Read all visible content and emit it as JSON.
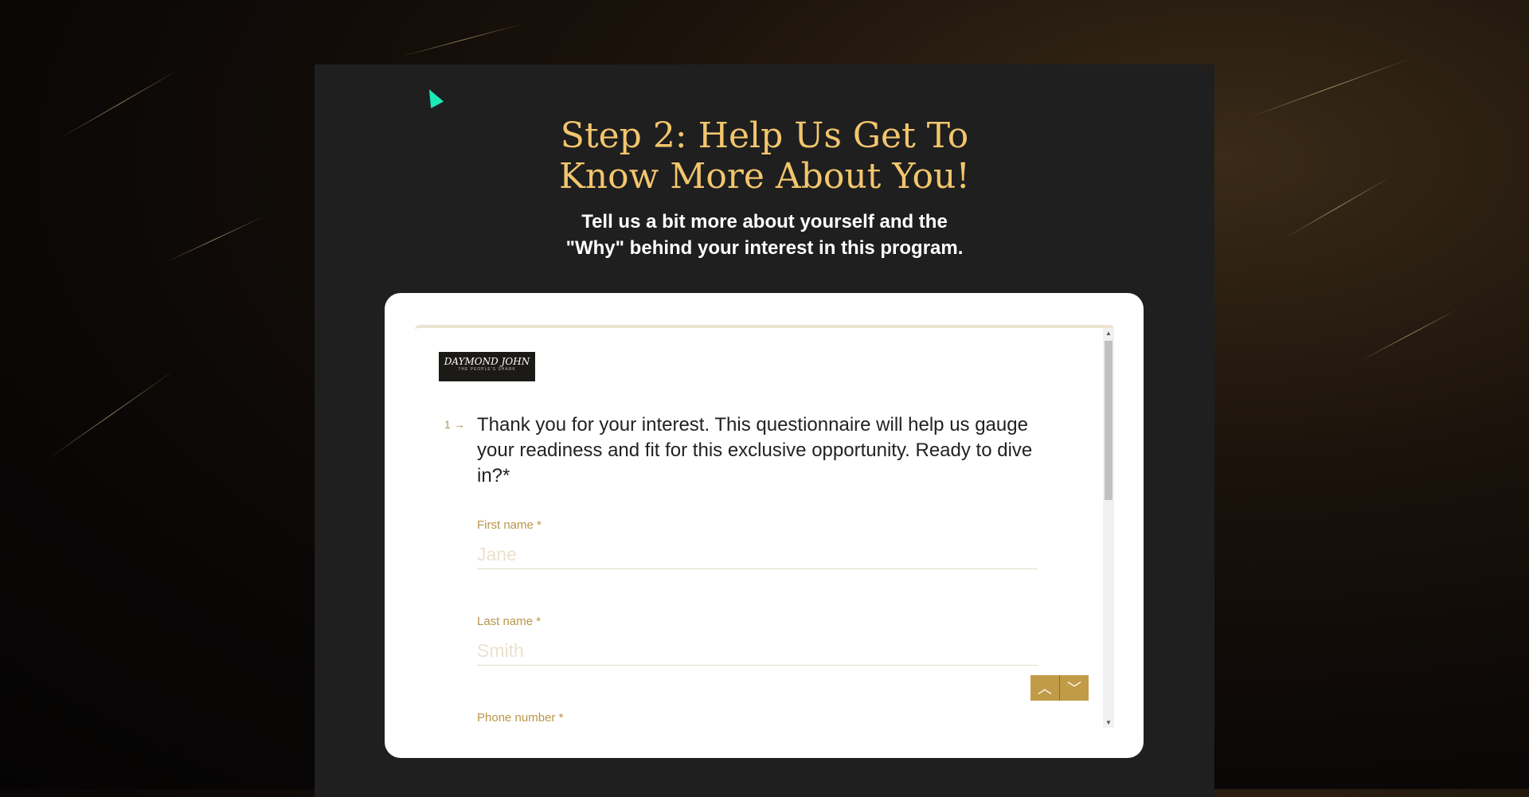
{
  "header": {
    "title_line1": "Step 2: Help Us Get To",
    "title_line2": "Know More About You!",
    "subtitle_line1": "Tell us a bit more about yourself and the",
    "subtitle_line2": "\"Why\" behind your interest in this program."
  },
  "form": {
    "logo": {
      "name": "DAYMOND JOHN",
      "tagline": "THE PEOPLE'S SHARK"
    },
    "question_number": "1",
    "question_text": "Thank you for your interest. This questionnaire will help us gauge your readiness and fit for this exclusive opportunity. Ready to dive in?*",
    "fields": [
      {
        "label": "First name *",
        "placeholder": "Jane",
        "value": ""
      },
      {
        "label": "Last name *",
        "placeholder": "Smith",
        "value": ""
      },
      {
        "label": "Phone number *"
      }
    ],
    "nav": {
      "up_icon": "chevron-up-icon",
      "down_icon": "chevron-down-icon"
    }
  },
  "colors": {
    "accent": "#c29b48",
    "title": "#f2c66d",
    "panel": "#1f1f1f"
  }
}
